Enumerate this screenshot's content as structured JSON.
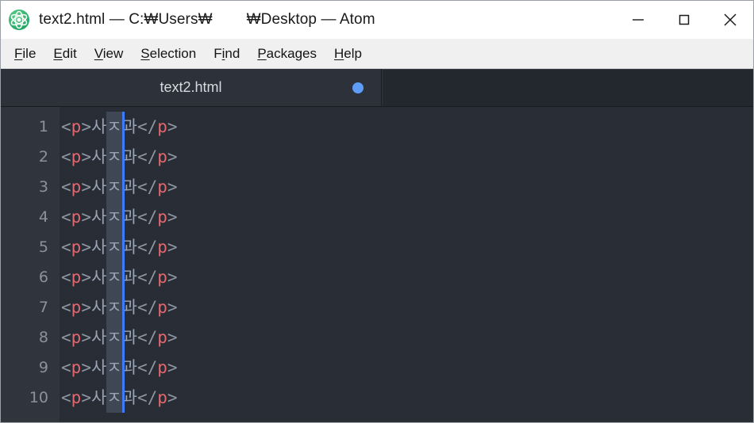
{
  "window": {
    "title": "text2.html — C:₩Users₩        ₩Desktop — Atom",
    "app_name": "Atom",
    "logo_icon": "atom-logo-icon",
    "controls": {
      "minimize_icon": "minimize-icon",
      "maximize_icon": "maximize-icon",
      "close_icon": "close-icon"
    }
  },
  "menu": {
    "items": [
      {
        "label": "File",
        "accel_index": 0
      },
      {
        "label": "Edit",
        "accel_index": 0
      },
      {
        "label": "View",
        "accel_index": 0
      },
      {
        "label": "Selection",
        "accel_index": 0
      },
      {
        "label": "Find",
        "accel_index": 1
      },
      {
        "label": "Packages",
        "accel_index": 0
      },
      {
        "label": "Help",
        "accel_index": 0
      }
    ]
  },
  "tabs": {
    "active": {
      "label": "text2.html",
      "modified": true,
      "modified_icon": "unsaved-dot-icon"
    }
  },
  "editor": {
    "language": "HTML",
    "line_count": 10,
    "line_numbers": [
      "1",
      "2",
      "3",
      "4",
      "5",
      "6",
      "7",
      "8",
      "9",
      "10"
    ],
    "line_text": "<p>사ㅈ과</p>",
    "tokens": [
      {
        "text": "<",
        "type": "punct"
      },
      {
        "text": "p",
        "type": "tagname"
      },
      {
        "text": ">",
        "type": "punct"
      },
      {
        "text": "사",
        "type": "text"
      },
      {
        "text": "ㅈ",
        "type": "text"
      },
      {
        "text": "과",
        "type": "text"
      },
      {
        "text": "</",
        "type": "punct"
      },
      {
        "text": "p",
        "type": "tagname"
      },
      {
        "text": ">",
        "type": "punct"
      }
    ],
    "lines": [
      "<p>사ㅈ과</p>",
      "<p>사ㅈ과</p>",
      "<p>사ㅈ과</p>",
      "<p>사ㅈ과</p>",
      "<p>사ㅈ과</p>",
      "<p>사ㅈ과</p>",
      "<p>사ㅈ과</p>",
      "<p>사ㅈ과</p>",
      "<p>사ㅈ과</p>",
      "<p>사ㅈ과</p>"
    ],
    "selection": {
      "kind": "column-selection",
      "selected_character": "ㅈ",
      "first_line": 1,
      "last_line": 10,
      "multi_cursor": true
    }
  },
  "colors": {
    "titlebar_bg": "#ffffff",
    "menubar_bg": "#f0f0f0",
    "tabbar_bg": "#1f2428",
    "tab_active_bg": "#2c313a",
    "editor_bg": "#282c34",
    "gutter_bg": "#2f343d",
    "line_number_fg": "#8b929c",
    "punct_fg": "#8d95a0",
    "tagname_fg": "#e4666f",
    "code_text_fg": "#98a3b3",
    "selection_bg": "#3f4654",
    "cursor_blue": "#3d7bfd",
    "modified_dot": "#5e9cf5",
    "logo_green": "#29a463"
  }
}
